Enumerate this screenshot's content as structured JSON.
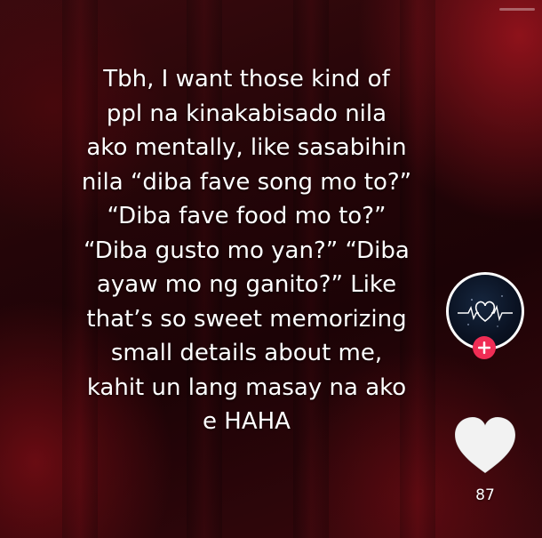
{
  "caption": {
    "lines": [
      "Tbh, I want those kind of",
      "ppl na kinakabisado nila",
      "ako mentally, like sasabihin",
      "nila “diba fave song mo to?”",
      "“Diba fave food mo to?”",
      "“Diba gusto mo yan?” “Diba",
      "ayaw mo ng ganito?” Like",
      "that’s so sweet memorizing",
      "small details about me,",
      "kahit un lang masay na ako",
      "e HAHA"
    ]
  },
  "sidebar": {
    "avatar_icon": "heartbeat-heart-icon",
    "follow_icon": "plus-icon",
    "like_icon": "heart-icon",
    "like_count": "87"
  },
  "colors": {
    "background": "#240508",
    "accent_red": "#a0141e",
    "follow_button": "#f02d55",
    "text": "#ffffff",
    "avatar_bg": "#0a1222"
  }
}
